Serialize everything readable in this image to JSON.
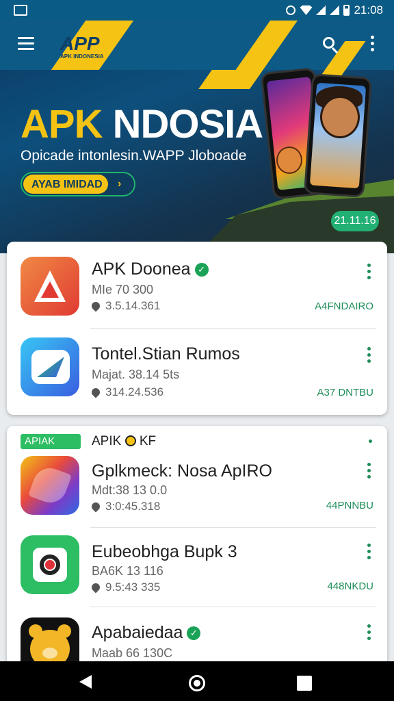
{
  "status_bar": {
    "time": "21:08"
  },
  "app_bar": {
    "logo_text": "APP",
    "logo_subtext": "APK INDONESIA"
  },
  "hero": {
    "title_part1": "APK",
    "title_part2": " NDOSIA",
    "subtitle": "Opicade intonlesin.WAPP Jloboade",
    "button_label": "AYAB IMIDAD",
    "badge": "21.11.16"
  },
  "apps_top": [
    {
      "name": "APK Doonea",
      "verified": true,
      "meta": "MIe 70 300",
      "version": "3.5.14.361",
      "tag": "A4FNDAIRO"
    },
    {
      "name": "Tontel.Stian Rumos",
      "verified": false,
      "meta": "Majat. 38.14 5ts",
      "version": "314.24.536",
      "tag": "A37 DNTBU"
    }
  ],
  "section": {
    "badge": "APIAK",
    "label": "APIK",
    "label_suffix": "KF"
  },
  "apps_bottom": [
    {
      "name": "Gplkmeck: Nosa ApIRO",
      "verified": false,
      "meta": "Mdt:38 13 0.0",
      "version": "3:0:45.318",
      "tag": "44PNNBU"
    },
    {
      "name": "Eubeobhga Bupk 3",
      "verified": false,
      "meta": "BA6K 13 116",
      "version": "9.5:43 335",
      "tag": "448NKDU"
    },
    {
      "name": "Apabaiedaa",
      "verified": true,
      "meta": "Maab 66 130C",
      "version": "",
      "tag": ""
    }
  ],
  "colors": {
    "primary": "#0d5a86",
    "accent_yellow": "#f5c314",
    "green": "#1d8d57"
  }
}
